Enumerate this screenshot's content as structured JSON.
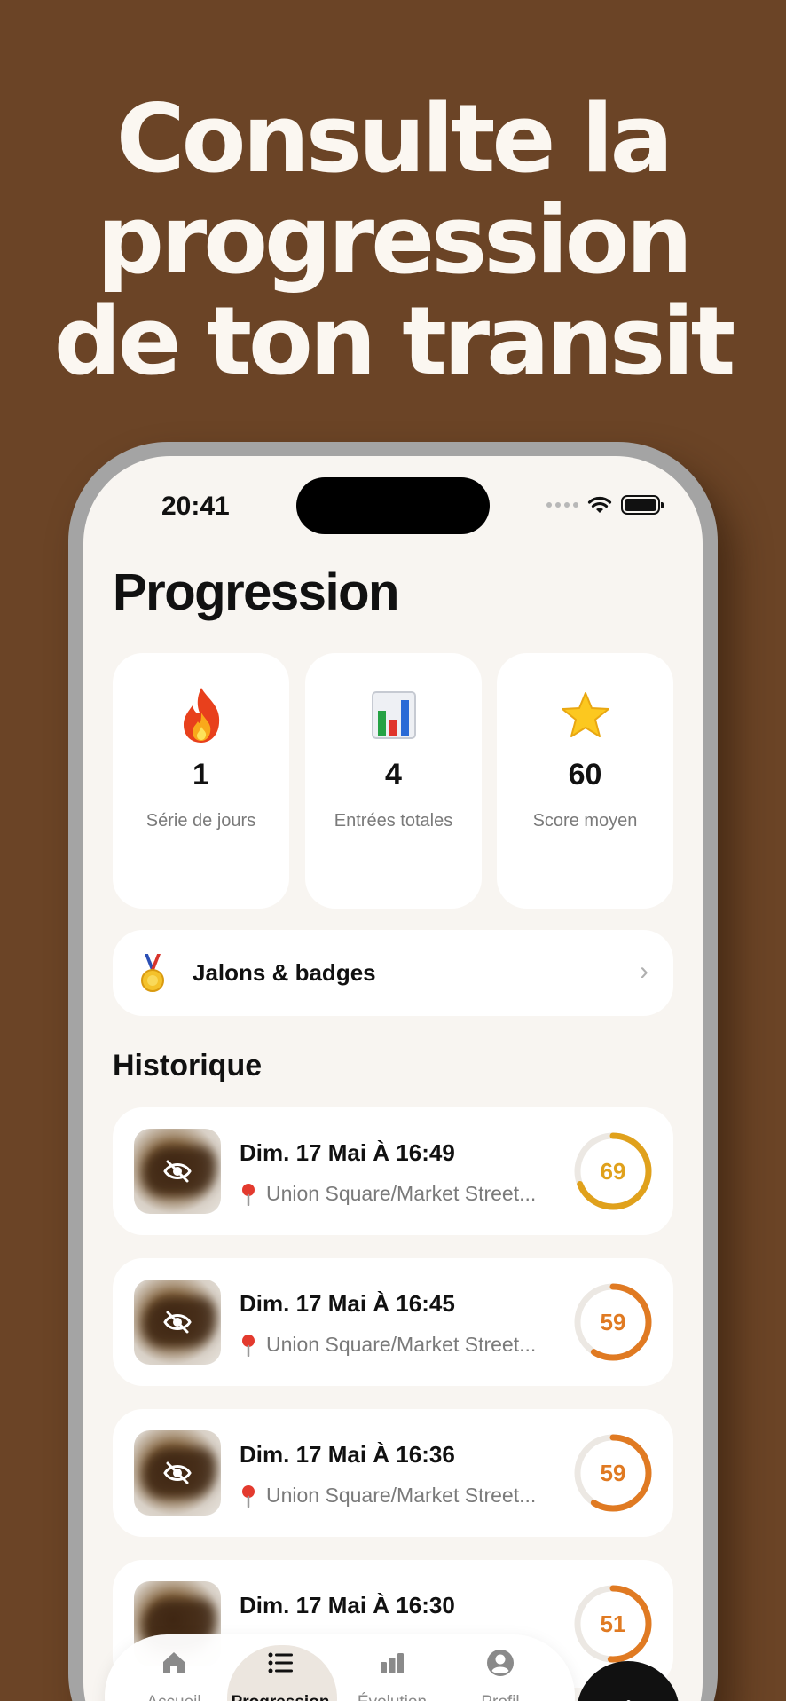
{
  "headline": {
    "line1": "Consulte la",
    "line2": "progression",
    "line3": "de ton transit"
  },
  "colors": {
    "background": "#6b4426",
    "screen": "#f8f5f1",
    "score_gold": "#e0a11c",
    "score_orange": "#e07a22"
  },
  "status_bar": {
    "time": "20:41"
  },
  "page": {
    "title": "Progression"
  },
  "stats": [
    {
      "icon": "fire-icon",
      "value": "1",
      "label": "Série de jours"
    },
    {
      "icon": "bar-chart-icon",
      "value": "4",
      "label": "Entrées totales"
    },
    {
      "icon": "star-icon",
      "value": "60",
      "label": "Score moyen"
    }
  ],
  "badges": {
    "icon": "medal-icon",
    "label": "Jalons & badges"
  },
  "history": {
    "title": "Historique",
    "entries": [
      {
        "date": "Dim. 17 Mai À 16:49",
        "location": "Union Square/Market Street...",
        "score": "69",
        "score_fraction": 0.69,
        "color": "#e0a11c"
      },
      {
        "date": "Dim. 17 Mai À 16:45",
        "location": "Union Square/Market Street...",
        "score": "59",
        "score_fraction": 0.59,
        "color": "#e07a22"
      },
      {
        "date": "Dim. 17 Mai À 16:36",
        "location": "Union Square/Market Street...",
        "score": "59",
        "score_fraction": 0.59,
        "color": "#e07a22"
      },
      {
        "date": "Dim. 17 Mai À 16:30",
        "location": "",
        "score": "51",
        "score_fraction": 0.51,
        "color": "#e07a22"
      }
    ]
  },
  "tabs": [
    {
      "icon": "home-icon",
      "label": "Accueil",
      "active": false
    },
    {
      "icon": "list-icon",
      "label": "Progression",
      "active": true
    },
    {
      "icon": "evolution-chart-icon",
      "label": "Évolution",
      "active": false
    },
    {
      "icon": "profile-icon",
      "label": "Profil",
      "active": false
    }
  ],
  "fab": {
    "icon": "plus-icon"
  }
}
